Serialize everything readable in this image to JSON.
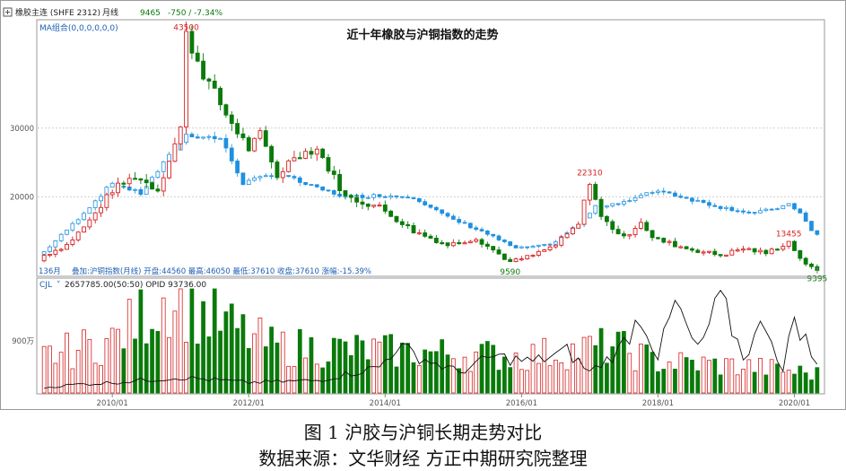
{
  "header": {
    "symbol": "橡胶主连 (SHFE 2312)",
    "period": "月线",
    "price": "9465",
    "change": "-750 / -7.34%"
  },
  "chart_title": "近十年橡胶与沪铜指数的走势",
  "indicator_label": "MA组合(0,0,0,0,0,0)",
  "bar_count_label": "136月",
  "overlay_info": "叠加:沪铜指数(月线)  开盘:44560  最高:46050  最低:37610  收盘:37610  涨幅:-15.39%",
  "price_labels": {
    "high": "43500",
    "mid": "22310",
    "low": "9590",
    "recent": "13455",
    "last": "9395"
  },
  "volume_indicator": "CJL",
  "volume_info": "2657785.00(50:50)  OPID 93736.00",
  "volume_tick": "900万",
  "caption": "图 1   沪胶与沪铜长期走势对比",
  "source": "数据来源：文华财经   方正中期研究院整理",
  "colors": {
    "up": "#d62020",
    "down": "#0a7a0a",
    "overlay": "#1e90e0",
    "oi_line": "#111111",
    "axis": "#888888"
  },
  "chart_data": {
    "type": "candlestick",
    "title": "近十年橡胶与沪铜指数的走势",
    "x_ticks": [
      "2010/01",
      "2012/01",
      "2014/01",
      "2016/01",
      "2018/01",
      "2020/01"
    ],
    "y_ticks": [
      20000,
      30000
    ],
    "ylim": [
      10000,
      45500
    ],
    "x_start": "2009/01",
    "x_end": "2020/05",
    "price_anchors": [
      [
        "2009/01",
        11500
      ],
      [
        "2009/05",
        13000
      ],
      [
        "2009/09",
        16500
      ],
      [
        "2010/01",
        21000
      ],
      [
        "2010/05",
        23000
      ],
      [
        "2010/09",
        21000
      ],
      [
        "2011/01",
        30000
      ],
      [
        "2011/02",
        43500
      ],
      [
        "2011/05",
        38000
      ],
      [
        "2011/09",
        32000
      ],
      [
        "2012/01",
        27000
      ],
      [
        "2012/03",
        29000
      ],
      [
        "2012/06",
        23000
      ],
      [
        "2012/09",
        26000
      ],
      [
        "2013/01",
        27000
      ],
      [
        "2013/06",
        20000
      ],
      [
        "2013/12",
        18500
      ],
      [
        "2014/06",
        15000
      ],
      [
        "2014/12",
        13000
      ],
      [
        "2015/05",
        14000
      ],
      [
        "2015/11",
        10500
      ],
      [
        "2016/03",
        11500
      ],
      [
        "2016/07",
        13000
      ],
      [
        "2016/11",
        16000
      ],
      [
        "2017/01",
        22310
      ],
      [
        "2017/03",
        17000
      ],
      [
        "2017/07",
        14000
      ],
      [
        "2017/10",
        16500
      ],
      [
        "2017/12",
        14000
      ],
      [
        "2018/06",
        12500
      ],
      [
        "2018/12",
        11500
      ],
      [
        "2019/04",
        12500
      ],
      [
        "2019/08",
        11800
      ],
      [
        "2019/12",
        13455
      ],
      [
        "2020/03",
        10000
      ],
      [
        "2020/05",
        9395
      ]
    ],
    "overlay_anchors": [
      [
        "2009/01",
        12000
      ],
      [
        "2009/06",
        16000
      ],
      [
        "2010/01",
        22000
      ],
      [
        "2010/06",
        20500
      ],
      [
        "2010/12",
        27000
      ],
      [
        "2011/02",
        29000
      ],
      [
        "2011/08",
        28500
      ],
      [
        "2011/12",
        22000
      ],
      [
        "2012/06",
        23500
      ],
      [
        "2012/12",
        21500
      ],
      [
        "2013/06",
        20000
      ],
      [
        "2013/12",
        20200
      ],
      [
        "2014/06",
        20000
      ],
      [
        "2014/12",
        17000
      ],
      [
        "2015/06",
        15000
      ],
      [
        "2015/12",
        12500
      ],
      [
        "2016/06",
        13000
      ],
      [
        "2016/11",
        16000
      ],
      [
        "2017/02",
        18500
      ],
      [
        "2017/08",
        19500
      ],
      [
        "2018/01",
        21000
      ],
      [
        "2018/06",
        19800
      ],
      [
        "2018/12",
        18500
      ],
      [
        "2019/06",
        17600
      ],
      [
        "2019/12",
        18800
      ],
      [
        "2020/02",
        17800
      ],
      [
        "2020/04",
        15000
      ],
      [
        "2020/05",
        14500
      ]
    ],
    "oi_anchors": [
      [
        "2009/01",
        0.05
      ],
      [
        "2009/06",
        0.08
      ],
      [
        "2010/01",
        0.1
      ],
      [
        "2011/01",
        0.15
      ],
      [
        "2012/01",
        0.1
      ],
      [
        "2013/01",
        0.12
      ],
      [
        "2013/12",
        0.25
      ],
      [
        "2014/03",
        0.45
      ],
      [
        "2014/09",
        0.3
      ],
      [
        "2015/02",
        0.2
      ],
      [
        "2015/08",
        0.35
      ],
      [
        "2016/03",
        0.3
      ],
      [
        "2016/09",
        0.4
      ],
      [
        "2017/01",
        0.2
      ],
      [
        "2017/06",
        0.4
      ],
      [
        "2017/10",
        0.75
      ],
      [
        "2018/01",
        0.35
      ],
      [
        "2018/04",
        0.85
      ],
      [
        "2018/08",
        0.4
      ],
      [
        "2018/12",
        0.9
      ],
      [
        "2019/04",
        0.35
      ],
      [
        "2019/08",
        0.7
      ],
      [
        "2019/11",
        0.2
      ],
      [
        "2020/01",
        0.75
      ],
      [
        "2020/05",
        0.25
      ]
    ]
  }
}
